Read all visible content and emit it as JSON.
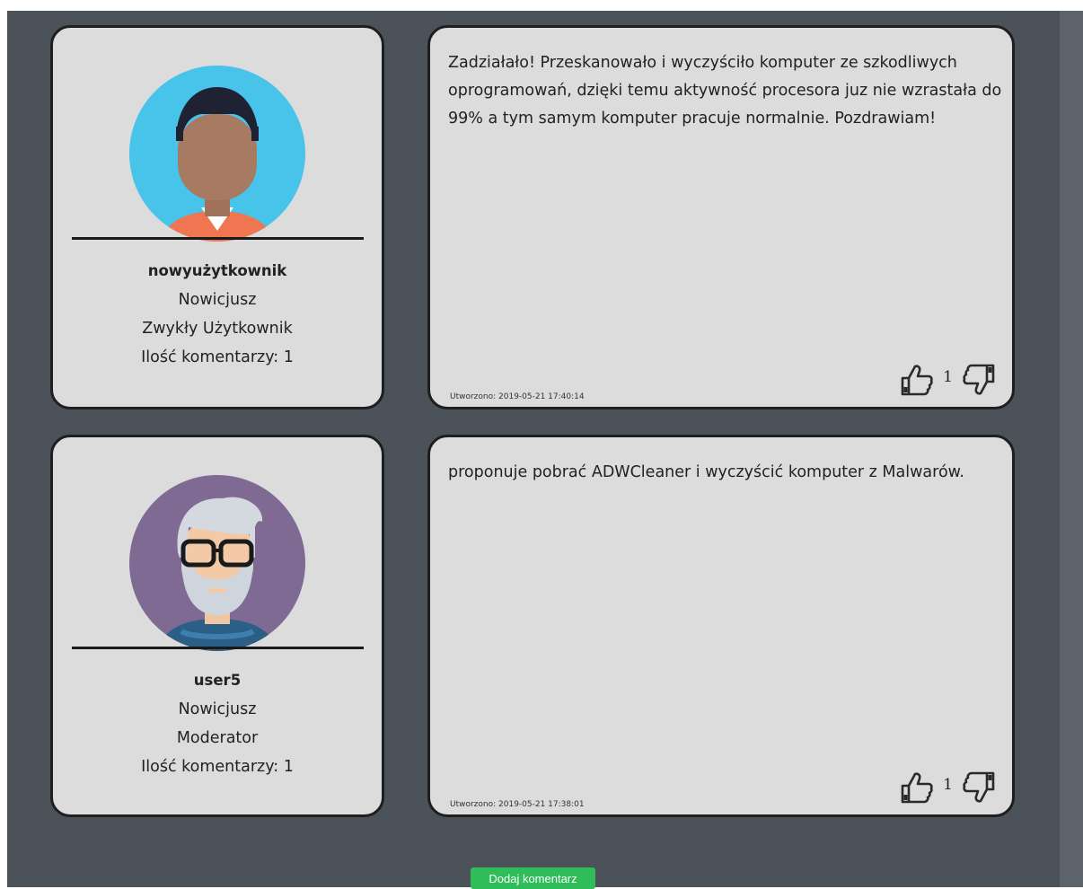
{
  "comments": [
    {
      "user": {
        "name": "nowyużytkownik",
        "rank": "Nowicjusz",
        "role": "Zwykły Użytkownik",
        "comment_count": "Ilość komentarzy: 1",
        "avatar": "man-avatar-icon"
      },
      "text": "Zadziałało! Przeskanowało i wyczyściło komputer ze szkodliwych oprogramowań, dzięki temu aktywność procesora juz nie wzrastała do 99% a tym samym komputer pracuje normalnie. Pozdrawiam!",
      "created": "Utworzono: 2019-05-21 17:40:14",
      "votes": "1"
    },
    {
      "user": {
        "name": "user5",
        "rank": "Nowicjusz",
        "role": "Moderator",
        "comment_count": "Ilość komentarzy: 1",
        "avatar": "old-man-avatar-icon"
      },
      "text": "proponuje pobrać ADWCleaner i wyczyścić komputer z Malwarów.",
      "created": "Utworzono: 2019-05-21 17:38:01",
      "votes": "1"
    }
  ],
  "add_comment_label": "Dodaj komentarz",
  "colors": {
    "background": "#4c5259",
    "card": "#dcdcdc",
    "card_border": "#1f1f1f",
    "button": "#2ebd59"
  }
}
